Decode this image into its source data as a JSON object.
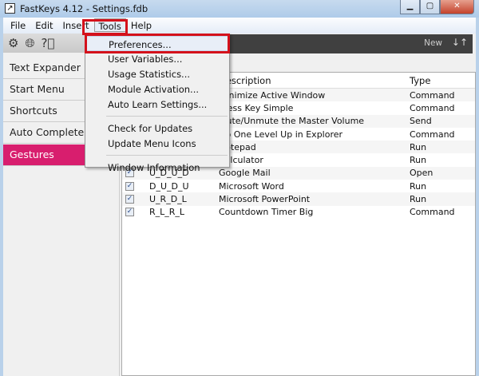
{
  "window": {
    "title": "FastKeys 4.12  - Settings.fdb",
    "minimize": "▁",
    "maximize": "▢",
    "close": "✕"
  },
  "menubar": [
    "File",
    "Edit",
    "Insert",
    "Tools",
    "Help"
  ],
  "toolbar": {
    "new_label": "New",
    "arrows": "↓↑"
  },
  "sidebar": {
    "icons": [
      "gear-icon",
      "globe-icon",
      "help-icon"
    ],
    "items": [
      "Text Expander",
      "Start Menu",
      "Shortcuts",
      "Auto Complete",
      "Gestures"
    ],
    "selected": "Gestures",
    "accent": "#d81e6e"
  },
  "tools_menu": {
    "group1": [
      "Preferences...",
      "User Variables...",
      "Usage Statistics...",
      "Module Activation...",
      "Auto Learn Settings..."
    ],
    "group2": [
      "Check for Updates",
      "Update Menu Icons"
    ],
    "group3": [
      "Window Information"
    ]
  },
  "table": {
    "headers": [
      "",
      "",
      "Description",
      "Type"
    ],
    "rows": [
      {
        "gesture": "",
        "description": "Minimize Active Window",
        "type": "Command"
      },
      {
        "gesture": "",
        "description": "Press Key Simple",
        "type": "Command"
      },
      {
        "gesture": "",
        "description": "Mute/Unmute the Master Volume",
        "type": "Send"
      },
      {
        "gesture": "",
        "description": "Go One Level Up in Explorer",
        "type": "Command"
      },
      {
        "gesture": "",
        "description": "Notepad",
        "type": "Run"
      },
      {
        "gesture": "",
        "description": "Calculator",
        "type": "Run"
      },
      {
        "gesture": "U_D_U_D",
        "description": "Google Mail",
        "type": "Open"
      },
      {
        "gesture": "D_U_D_U",
        "description": "Microsoft Word",
        "type": "Run"
      },
      {
        "gesture": "U_R_D_L",
        "description": "Microsoft PowerPoint",
        "type": "Run"
      },
      {
        "gesture": "R_L_R_L",
        "description": "Countdown Timer Big",
        "type": "Command"
      }
    ]
  }
}
